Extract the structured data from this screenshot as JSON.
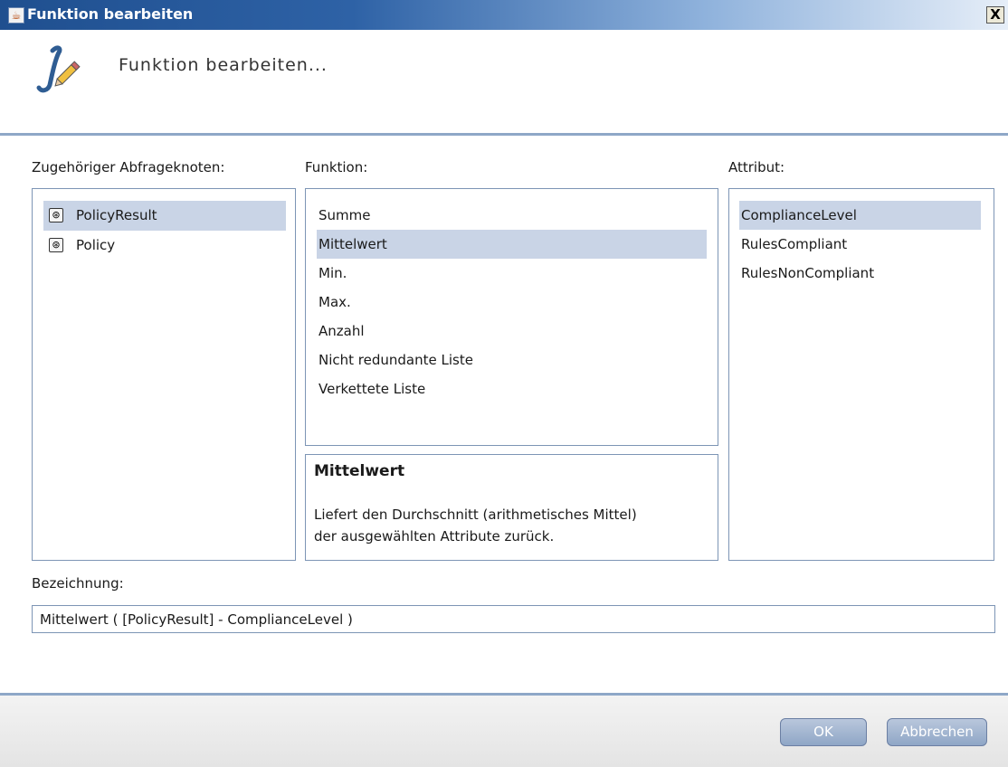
{
  "window": {
    "title": "Funktion bearbeiten",
    "close_label": "X"
  },
  "header": {
    "title": "Funktion bearbeiten..."
  },
  "labels": {
    "nodes": "Zugehöriger Abfrageknoten:",
    "function": "Funktion:",
    "attribute": "Attribut:",
    "name": "Bezeichnung:"
  },
  "nodes": [
    {
      "label": "PolicyResult",
      "selected": true
    },
    {
      "label": "Policy",
      "selected": false
    }
  ],
  "functions": [
    {
      "label": "Summe",
      "selected": false
    },
    {
      "label": "Mittelwert",
      "selected": true
    },
    {
      "label": "Min.",
      "selected": false
    },
    {
      "label": "Max.",
      "selected": false
    },
    {
      "label": "Anzahl",
      "selected": false
    },
    {
      "label": "Nicht redundante Liste",
      "selected": false
    },
    {
      "label": "Verkettete Liste",
      "selected": false
    }
  ],
  "description": {
    "title": "Mittelwert",
    "text_line1": "Liefert den Durchschnitt (arithmetisches Mittel)",
    "text_line2": "der ausgewählten Attribute zurück."
  },
  "attributes": [
    {
      "label": "ComplianceLevel",
      "selected": true
    },
    {
      "label": "RulesCompliant",
      "selected": false
    },
    {
      "label": "RulesNonCompliant",
      "selected": false
    }
  ],
  "name_field": {
    "value": "Mittelwert ( [PolicyResult] - ComplianceLevel )"
  },
  "buttons": {
    "ok": "OK",
    "cancel": "Abbrechen"
  },
  "icons": {
    "title": "java-cup-icon",
    "function": "function-edit-icon",
    "node": "node-cube-icon"
  },
  "colors": {
    "selection": "#c9d4e6",
    "title_bar": "#2e62a6"
  }
}
